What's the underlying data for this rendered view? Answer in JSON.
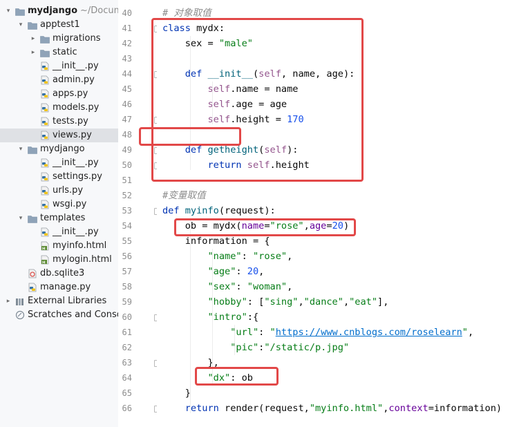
{
  "project_tree": {
    "rows": [
      {
        "label": "mydjango",
        "suffix": "~/Docume",
        "type": "folder",
        "expanded": true,
        "bold": true,
        "depth": 0
      },
      {
        "label": "apptest1",
        "type": "folder",
        "expanded": true,
        "depth": 1
      },
      {
        "label": "migrations",
        "type": "folder",
        "expanded": false,
        "depth": 2
      },
      {
        "label": "static",
        "type": "folder",
        "expanded": false,
        "depth": 2
      },
      {
        "label": "__init__.py",
        "type": "python",
        "depth": 2
      },
      {
        "label": "admin.py",
        "type": "python",
        "depth": 2
      },
      {
        "label": "apps.py",
        "type": "python",
        "depth": 2
      },
      {
        "label": "models.py",
        "type": "python",
        "depth": 2
      },
      {
        "label": "tests.py",
        "type": "python",
        "depth": 2
      },
      {
        "label": "views.py",
        "type": "python",
        "depth": 2,
        "selected": true
      },
      {
        "label": "mydjango",
        "type": "folder",
        "expanded": true,
        "depth": 1
      },
      {
        "label": "__init__.py",
        "type": "python",
        "depth": 2
      },
      {
        "label": "settings.py",
        "type": "python",
        "depth": 2
      },
      {
        "label": "urls.py",
        "type": "python",
        "depth": 2
      },
      {
        "label": "wsgi.py",
        "type": "python",
        "depth": 2
      },
      {
        "label": "templates",
        "type": "folder",
        "expanded": true,
        "depth": 1
      },
      {
        "label": "__init__.py",
        "type": "python",
        "depth": 2
      },
      {
        "label": "myinfo.html",
        "type": "html",
        "depth": 2
      },
      {
        "label": "mylogin.html",
        "type": "html",
        "depth": 2
      },
      {
        "label": "db.sqlite3",
        "type": "db",
        "depth": 1
      },
      {
        "label": "manage.py",
        "type": "python",
        "depth": 1
      },
      {
        "label": "External Libraries",
        "type": "library",
        "expanded": false,
        "depth": 0
      },
      {
        "label": "Scratches and Consol",
        "type": "scratch",
        "depth": 0
      }
    ]
  },
  "editor": {
    "lines": [
      {
        "n": "40",
        "tokens": [
          [
            "com",
            "# 对象取值"
          ]
        ]
      },
      {
        "n": "41",
        "tokens": [
          [
            "kw",
            "class "
          ],
          [
            "",
            "mydx:"
          ]
        ]
      },
      {
        "n": "42",
        "tokens": [
          [
            "",
            "    sex = "
          ],
          [
            "str",
            "\"male\""
          ]
        ]
      },
      {
        "n": "43",
        "tokens": []
      },
      {
        "n": "44",
        "tokens": [
          [
            "",
            "    "
          ],
          [
            "kw",
            "def "
          ],
          [
            "fn",
            "__init__"
          ],
          [
            "",
            "("
          ],
          [
            "self",
            "self"
          ],
          [
            "",
            ", name, age):"
          ]
        ]
      },
      {
        "n": "45",
        "tokens": [
          [
            "",
            "        "
          ],
          [
            "self",
            "self"
          ],
          [
            "",
            ".name = name"
          ]
        ]
      },
      {
        "n": "46",
        "tokens": [
          [
            "",
            "        "
          ],
          [
            "self",
            "self"
          ],
          [
            "",
            ".age = age"
          ]
        ]
      },
      {
        "n": "47",
        "tokens": [
          [
            "",
            "        "
          ],
          [
            "self",
            "self"
          ],
          [
            "",
            ".height = "
          ],
          [
            "num",
            "170"
          ]
        ]
      },
      {
        "n": "48",
        "tokens": []
      },
      {
        "n": "49",
        "tokens": [
          [
            "",
            "    "
          ],
          [
            "kw",
            "def "
          ],
          [
            "fn",
            "getheight"
          ],
          [
            "",
            "("
          ],
          [
            "self",
            "self"
          ],
          [
            "",
            "):"
          ]
        ]
      },
      {
        "n": "50",
        "tokens": [
          [
            "",
            "        "
          ],
          [
            "kw",
            "return "
          ],
          [
            "self",
            "self"
          ],
          [
            "",
            ".height"
          ]
        ]
      },
      {
        "n": "51",
        "tokens": []
      },
      {
        "n": "52",
        "tokens": [
          [
            "com",
            "#变量取值"
          ]
        ]
      },
      {
        "n": "53",
        "tokens": [
          [
            "kw",
            "def "
          ],
          [
            "fn",
            "myinfo"
          ],
          [
            "",
            "(request):"
          ]
        ]
      },
      {
        "n": "54",
        "tokens": [
          [
            "",
            "    ob = mydx("
          ],
          [
            "named",
            "name"
          ],
          [
            "",
            "="
          ],
          [
            "str",
            "\"rose\""
          ],
          [
            "",
            ","
          ],
          [
            "named",
            "age"
          ],
          [
            "",
            "="
          ],
          [
            "num",
            "20"
          ],
          [
            "",
            ")"
          ]
        ]
      },
      {
        "n": "55",
        "tokens": [
          [
            "",
            "    information = {"
          ]
        ]
      },
      {
        "n": "56",
        "tokens": [
          [
            "",
            "        "
          ],
          [
            "str",
            "\"name\""
          ],
          [
            "",
            ": "
          ],
          [
            "str",
            "\"rose\""
          ],
          [
            "",
            ","
          ]
        ]
      },
      {
        "n": "57",
        "tokens": [
          [
            "",
            "        "
          ],
          [
            "str",
            "\"age\""
          ],
          [
            "",
            ": "
          ],
          [
            "num",
            "20"
          ],
          [
            "",
            ","
          ]
        ]
      },
      {
        "n": "58",
        "tokens": [
          [
            "",
            "        "
          ],
          [
            "str",
            "\"sex\""
          ],
          [
            "",
            ": "
          ],
          [
            "str",
            "\"woman\""
          ],
          [
            "",
            ","
          ]
        ]
      },
      {
        "n": "59",
        "tokens": [
          [
            "",
            "        "
          ],
          [
            "str",
            "\"hobby\""
          ],
          [
            "",
            ": ["
          ],
          [
            "str",
            "\"sing\""
          ],
          [
            "",
            ","
          ],
          [
            "str",
            "\"dance\""
          ],
          [
            "",
            ","
          ],
          [
            "str",
            "\"eat\""
          ],
          [
            "",
            "],"
          ]
        ]
      },
      {
        "n": "60",
        "tokens": [
          [
            "",
            "        "
          ],
          [
            "str",
            "\"intro\""
          ],
          [
            "",
            ":{"
          ]
        ]
      },
      {
        "n": "61",
        "tokens": [
          [
            "",
            "            "
          ],
          [
            "str",
            "\"url\""
          ],
          [
            "",
            ": "
          ],
          [
            "str",
            "\""
          ],
          [
            "url",
            "https://www.cnblogs.com/roselearn"
          ],
          [
            "str",
            "\""
          ],
          [
            "",
            ","
          ]
        ]
      },
      {
        "n": "62",
        "tokens": [
          [
            "",
            "            "
          ],
          [
            "str",
            "\"pic\""
          ],
          [
            "",
            ":"
          ],
          [
            "str",
            "\"/static/p.jpg\""
          ]
        ]
      },
      {
        "n": "63",
        "tokens": [
          [
            "",
            "        },"
          ]
        ]
      },
      {
        "n": "64",
        "tokens": [
          [
            "",
            "        "
          ],
          [
            "str",
            "\"dx\""
          ],
          [
            "",
            ": ob"
          ]
        ]
      },
      {
        "n": "65",
        "tokens": [
          [
            "",
            "    }"
          ]
        ]
      },
      {
        "n": "66",
        "tokens": [
          [
            "",
            "    "
          ],
          [
            "kw",
            "return "
          ],
          [
            "",
            "render(request,"
          ],
          [
            "str",
            "\"myinfo.html\""
          ],
          [
            "",
            ","
          ],
          [
            "named",
            "context"
          ],
          [
            "",
            "=information)"
          ]
        ]
      }
    ],
    "current_line": "63"
  },
  "colors": {
    "highlight_box": "#e24848",
    "keyword": "#0033b3",
    "string": "#067d17",
    "number": "#1750eb",
    "self": "#94558d"
  }
}
